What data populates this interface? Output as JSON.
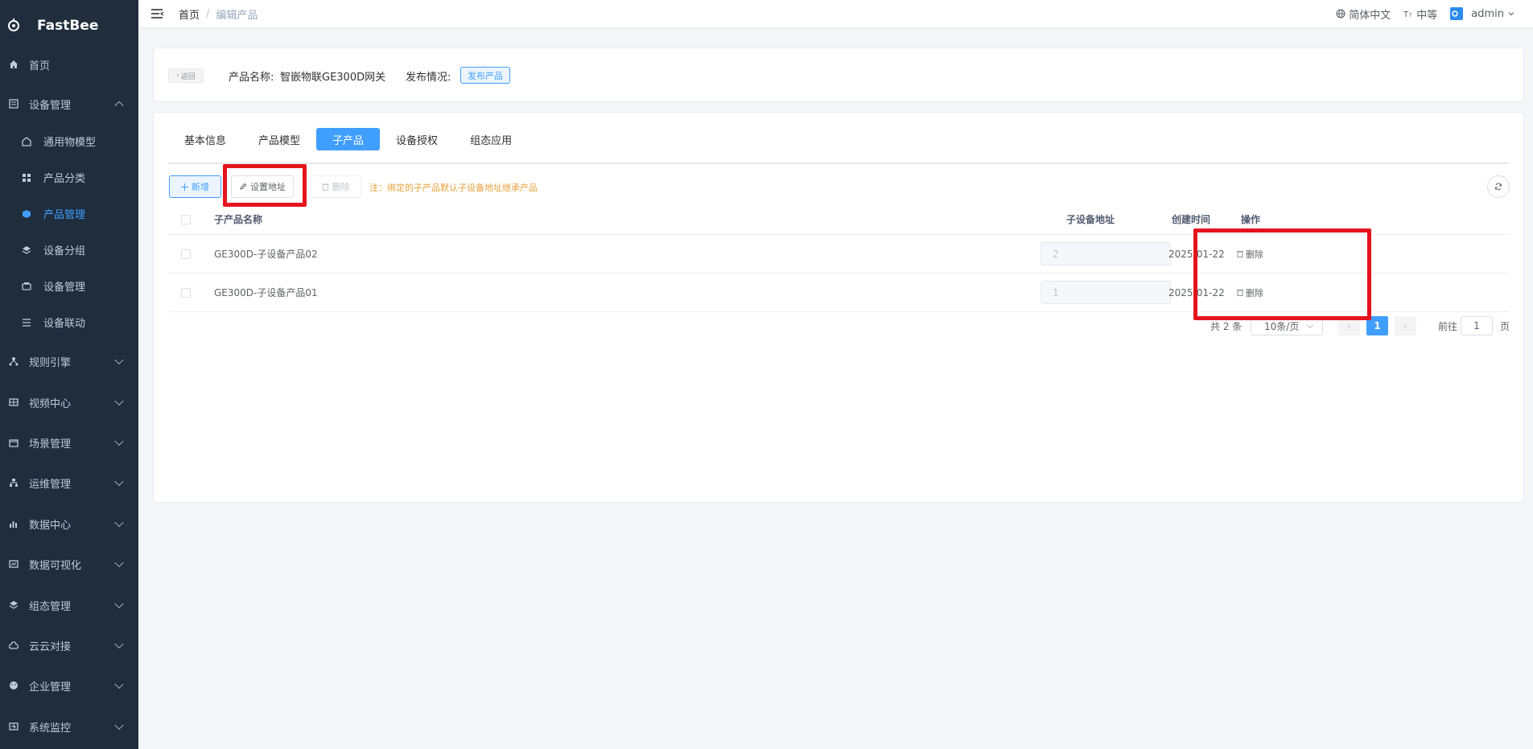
{
  "sidebar": {
    "logo": "FastBee",
    "items": [
      {
        "label": "首页",
        "icon": "home-icon"
      },
      {
        "label": "设备管理",
        "icon": "device-manage-icon"
      },
      {
        "label": "规则引擎",
        "icon": "rule-engine-icon"
      },
      {
        "label": "视频中心",
        "icon": "video-center-icon"
      },
      {
        "label": "场景管理",
        "icon": "scene-icon"
      },
      {
        "label": "运维管理",
        "icon": "ops-icon"
      },
      {
        "label": "数据中心",
        "icon": "data-center-icon"
      },
      {
        "label": "数据可视化",
        "icon": "visualization-icon"
      },
      {
        "label": "组态管理",
        "icon": "scada-icon"
      },
      {
        "label": "云云对接",
        "icon": "cloud-icon"
      },
      {
        "label": "企业管理",
        "icon": "enterprise-icon"
      },
      {
        "label": "系统监控",
        "icon": "monitor-icon"
      }
    ],
    "sub_items": [
      {
        "label": "通用物模型",
        "icon": "model-icon"
      },
      {
        "label": "产品分类",
        "icon": "category-icon"
      },
      {
        "label": "产品管理",
        "icon": "product-icon"
      },
      {
        "label": "设备分组",
        "icon": "group-icon"
      },
      {
        "label": "设备管理",
        "icon": "device-icon"
      },
      {
        "label": "设备联动",
        "icon": "linkage-icon"
      }
    ]
  },
  "header": {
    "breadcrumb_home": "首页",
    "breadcrumb_sep": "/",
    "breadcrumb_current": "编辑产品",
    "language": "简体中文",
    "font_size": "中等",
    "user": "admin"
  },
  "product_info": {
    "back_label": "返回",
    "name_label": "产品名称:",
    "name_value": "智嵌物联GE300D网关",
    "publish_label": "发布情况:",
    "publish_button": "发布产品"
  },
  "tabs": [
    "基本信息",
    "产品模型",
    "子产品",
    "设备授权",
    "组态应用"
  ],
  "toolbar": {
    "add_label": "新增",
    "set_address_label": "设置地址",
    "delete_label": "删除",
    "note": "注：绑定的子产品默认子设备地址继承产品"
  },
  "table": {
    "headers": {
      "name": "子产品名称",
      "address": "子设备地址",
      "created": "创建时间",
      "actions": "操作"
    },
    "rows": [
      {
        "name": "GE300D-子设备产品02",
        "address": "2",
        "created": "2025-01-22",
        "action": "删除"
      },
      {
        "name": "GE300D-子设备产品01",
        "address": "1",
        "created": "2025-01-22",
        "action": "删除"
      }
    ]
  },
  "pagination": {
    "total": "共 2 条",
    "page_size": "10条/页",
    "current_page": "1",
    "goto_label": "前往",
    "goto_value": "1",
    "page_label": "页"
  },
  "colors": {
    "sidebar_bg": "#1f2d3d",
    "accent": "#409eff",
    "highlight": "#e5141c",
    "warning": "#e6a23c"
  }
}
